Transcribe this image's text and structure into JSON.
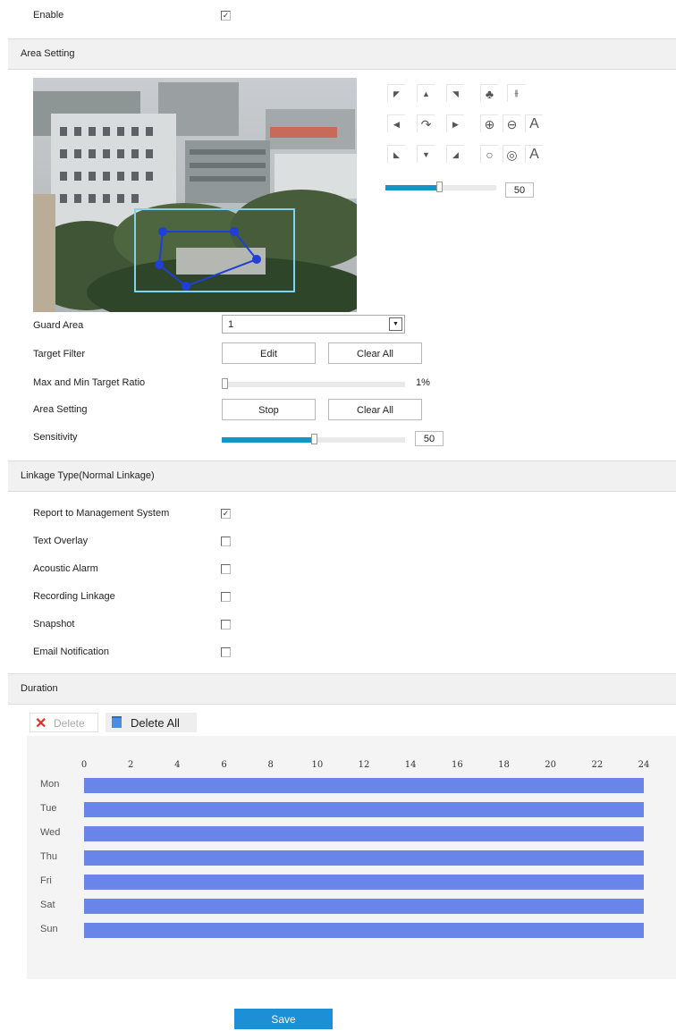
{
  "enable": {
    "label": "Enable",
    "checked": true
  },
  "area_setting_section": {
    "title": "Area Setting"
  },
  "ptz": {
    "row1": [
      "◤",
      "▲",
      "◥"
    ],
    "row2": [
      "◀",
      "↷",
      "▶"
    ],
    "row3": [
      "◣",
      "▼",
      "◢"
    ],
    "extra_row1": [
      "tree-icon",
      "focus-far-icon"
    ],
    "extra_row2": [
      "zoom-in-icon",
      "zoom-out-icon",
      "A"
    ],
    "extra_row3": [
      "iris-open-icon",
      "iris-close-icon",
      "A"
    ],
    "speed_value": "50",
    "speed_fraction": 0.48
  },
  "guard_area": {
    "label": "Guard Area",
    "value": "1"
  },
  "target_filter": {
    "label": "Target Filter",
    "edit": "Edit",
    "clear": "Clear All"
  },
  "target_ratio": {
    "label": "Max and Min Target Ratio",
    "value": "1%",
    "fraction": 0.01
  },
  "area_setting_row": {
    "label": "Area Setting",
    "stop": "Stop",
    "clear": "Clear All"
  },
  "sensitivity": {
    "label": "Sensitivity",
    "value": "50",
    "fraction": 0.5
  },
  "linkage_section": {
    "title": "Linkage Type(Normal Linkage)"
  },
  "linkage": [
    {
      "label": "Report to Management System",
      "checked": true,
      "mark": "✓"
    },
    {
      "label": "Text Overlay",
      "checked": false,
      "mark": ""
    },
    {
      "label": "Acoustic Alarm",
      "checked": false,
      "mark": ""
    },
    {
      "label": "Recording Linkage",
      "checked": false,
      "mark": ""
    },
    {
      "label": "Snapshot",
      "checked": false,
      "mark": ""
    },
    {
      "label": "Email Notification",
      "checked": false,
      "mark": ""
    }
  ],
  "duration_section": {
    "title": "Duration"
  },
  "duration_toolbar": {
    "delete": "Delete",
    "delete_all": "Delete All"
  },
  "schedule": {
    "hours": [
      "0",
      "2",
      "4",
      "6",
      "8",
      "10",
      "12",
      "14",
      "16",
      "18",
      "20",
      "22",
      "24"
    ],
    "days": [
      "Mon",
      "Tue",
      "Wed",
      "Thu",
      "Fri",
      "Sat",
      "Sun"
    ],
    "ranges": [
      [
        0,
        24
      ],
      [
        0,
        24
      ],
      [
        0,
        24
      ],
      [
        0,
        24
      ],
      [
        0,
        24
      ],
      [
        0,
        24
      ],
      [
        0,
        24
      ]
    ]
  },
  "save": "Save",
  "colors": {
    "accent": "#1296c7",
    "schedule_bar": "#6a85ea",
    "save_button": "#1c8fd6",
    "region_line": "#1f3fd6",
    "roi_box": "#7fd3ec"
  }
}
